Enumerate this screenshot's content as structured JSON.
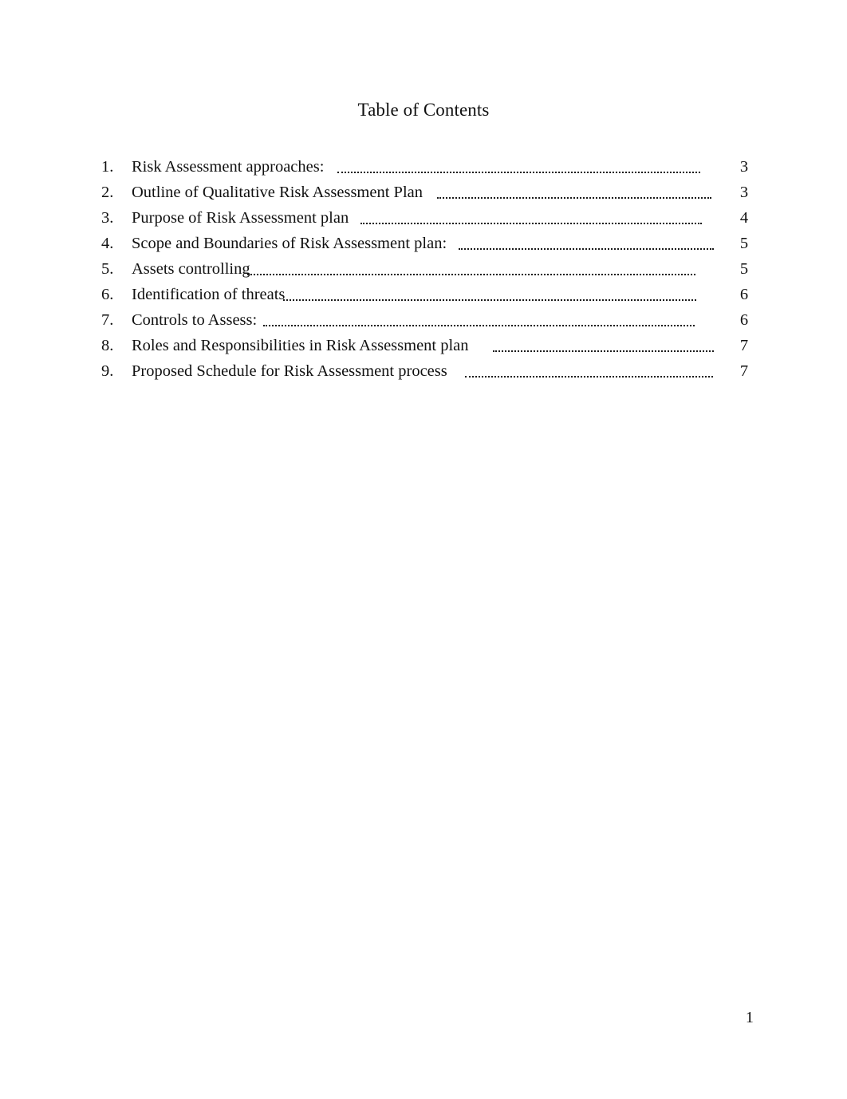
{
  "document": {
    "title": "Table of Contents",
    "page_number": "1",
    "text_color": "#111111",
    "background_color": "#ffffff"
  },
  "toc": {
    "entries": [
      {
        "number": "1.",
        "label": "Risk Assessment approaches:",
        "page": "3",
        "leader_start": 423,
        "leader_end": 878
      },
      {
        "number": "2.",
        "label": "Outline of Qualitative Risk Assessment Plan",
        "page": "3",
        "leader_start": 548,
        "leader_end": 892
      },
      {
        "number": "3.",
        "label": "Purpose of Risk Assessment plan",
        "page": "4",
        "leader_start": 452,
        "leader_end": 880
      },
      {
        "number": "4.",
        "label": "Scope and Boundaries of Risk Assessment plan:",
        "page": "5",
        "leader_start": 575,
        "leader_end": 895
      },
      {
        "number": "5.",
        "label": "Assets controlling",
        "page": "5",
        "leader_start": 310,
        "leader_end": 872
      },
      {
        "number": "6.",
        "label": "Identification of threats",
        "page": "6",
        "leader_start": 355,
        "leader_end": 873
      },
      {
        "number": "7.",
        "label": "Controls to Assess:",
        "page": "6",
        "leader_start": 330,
        "leader_end": 871
      },
      {
        "number": "8.",
        "label": "Roles and Responsibilities in Risk Assessment plan",
        "page": "7",
        "leader_start": 618,
        "leader_end": 895
      },
      {
        "number": "9.",
        "label": "Proposed Schedule for Risk Assessment process",
        "page": "7",
        "leader_start": 583,
        "leader_end": 894
      }
    ]
  }
}
